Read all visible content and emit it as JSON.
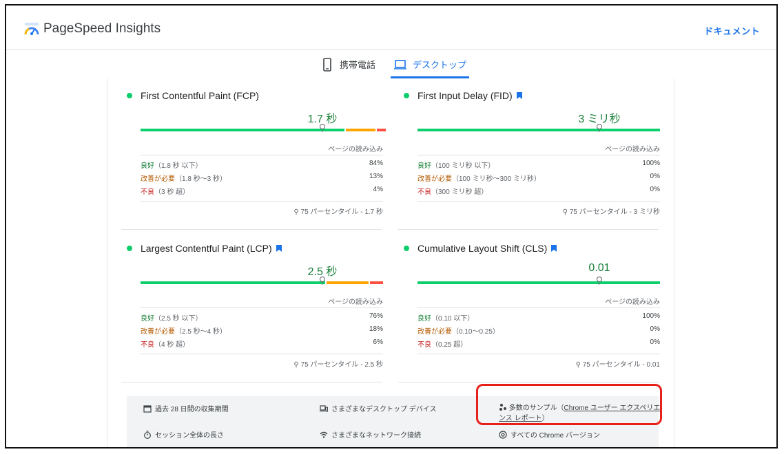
{
  "app": {
    "brand": "PageSpeed Insights",
    "doc_link": "ドキュメント"
  },
  "tabs": [
    {
      "label": "携帯電話",
      "icon": "smartphone-icon",
      "active": false
    },
    {
      "label": "デスクトップ",
      "icon": "laptop-icon",
      "active": true
    }
  ],
  "colors": {
    "good": "#0cce6b",
    "needs_improvement": "#ffa400",
    "poor": "#ff4e42",
    "accent": "#1a73e8"
  },
  "metrics": {
    "fcp": {
      "title": "First Contentful Paint (FCP)",
      "value": "1.7 秒",
      "marker": 0.75,
      "segments": [
        0.84,
        0.13,
        0.04
      ],
      "page_load": "ページの読み込み",
      "rows": [
        {
          "label": "良好",
          "range": "（1.8 秒 以下）",
          "pct": "84%"
        },
        {
          "label": "改善が必要",
          "range": "（1.8 秒〜3 秒）",
          "pct": "13%"
        },
        {
          "label": "不良",
          "range": "（3 秒 超）",
          "pct": "4%"
        }
      ],
      "p75": "75 パーセンタイル - 1.7 秒"
    },
    "fid": {
      "title": "First Input Delay (FID)",
      "value": "3 ミリ秒",
      "marker": 0.75,
      "segments": [
        1.0,
        0.0,
        0.0
      ],
      "page_load": "ページの読み込み",
      "rows": [
        {
          "label": "良好",
          "range": "（100 ミリ秒 以下）",
          "pct": "100%"
        },
        {
          "label": "改善が必要",
          "range": "（100 ミリ秒〜300 ミリ秒）",
          "pct": "0%"
        },
        {
          "label": "不良",
          "range": "（300 ミリ秒 超）",
          "pct": "0%"
        }
      ],
      "p75": "75 パーセンタイル - 3 ミリ秒"
    },
    "lcp": {
      "title": "Largest Contentful Paint (LCP)",
      "value": "2.5 秒",
      "marker": 0.75,
      "segments": [
        0.76,
        0.18,
        0.06
      ],
      "page_load": "ページの読み込み",
      "rows": [
        {
          "label": "良好",
          "range": "（2.5 秒 以下）",
          "pct": "76%"
        },
        {
          "label": "改善が必要",
          "range": "（2.5 秒〜4 秒）",
          "pct": "18%"
        },
        {
          "label": "不良",
          "range": "（4 秒 超）",
          "pct": "6%"
        }
      ],
      "p75": "75 パーセンタイル - 2.5 秒"
    },
    "cls": {
      "title": "Cumulative Layout Shift (CLS)",
      "value": "0.01",
      "marker": 0.75,
      "segments": [
        1.0,
        0.0,
        0.0
      ],
      "page_load": "ページの読み込み",
      "rows": [
        {
          "label": "良好",
          "range": "（0.10 以下）",
          "pct": "100%"
        },
        {
          "label": "改善が必要",
          "range": "（0.10〜0.25）",
          "pct": "0%"
        },
        {
          "label": "不良",
          "range": "（0.25 超）",
          "pct": "0%"
        }
      ],
      "p75": "75 パーセンタイル - 0.01"
    }
  },
  "footer": {
    "collection_period": "過去 28 日間の収集期間",
    "devices": "さまざまなデスクトップ デバイス",
    "samples_prefix": "多数のサンプル（",
    "samples_link": "Chrome ユーザー エクスペリエンス レポート",
    "samples_suffix": "）",
    "session": "セッション全体の長さ",
    "network": "さまざまなネットワーク接続",
    "versions": "すべての Chrome バージョン"
  }
}
